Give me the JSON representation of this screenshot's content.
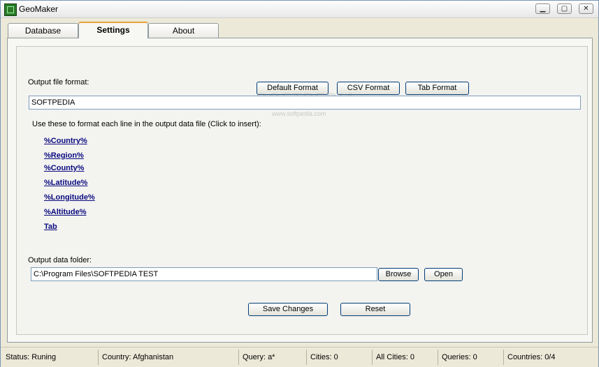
{
  "window": {
    "title": "GeoMaker"
  },
  "tabs": [
    {
      "label": "Database"
    },
    {
      "label": "Settings"
    },
    {
      "label": "About"
    }
  ],
  "settings": {
    "output_format_label": "Output file format:",
    "buttons": {
      "default_format": "Default Format",
      "csv_format": "CSV Format",
      "tab_format": "Tab Format"
    },
    "format_value": "SOFTPEDIA",
    "instructions": "Use these to format each line in the output data file (Click to insert):",
    "tokens": [
      "%Country%",
      "%Region%",
      "%County%",
      "%Latitude%",
      "%Longitude%",
      "%Altitude%",
      "Tab"
    ],
    "output_folder_label": "Output data folder:",
    "folder_value": "C:\\Program Files\\SOFTPEDIA TEST",
    "browse": "Browse",
    "open": "Open",
    "save_changes": "Save Changes",
    "reset": "Reset"
  },
  "status": {
    "status": "Status: Runing",
    "country": "Country: Afghanistan",
    "query": "Query: a*",
    "cities": "Cities: 0",
    "all_cities": "All Cities: 0",
    "queries": "Queries: 0",
    "countries": "Countries: 0/4"
  }
}
